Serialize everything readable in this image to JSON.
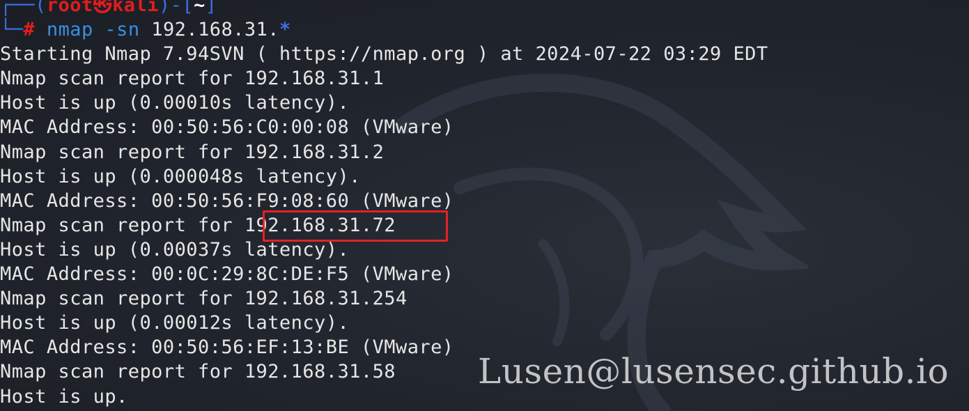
{
  "prompt": {
    "corner_top": "┌──(",
    "user": "root㉿kali",
    "close_bracket": ")-[",
    "cwd": "~",
    "end_bracket": "]",
    "corner_bottom": "└─",
    "hash": "#"
  },
  "command": {
    "program": "nmap",
    "flag": "-sn",
    "target": "192.168.31.",
    "wildcard": "*"
  },
  "output": [
    "Starting Nmap 7.94SVN ( https://nmap.org ) at 2024-07-22 03:29 EDT",
    "Nmap scan report for 192.168.31.1",
    "Host is up (0.00010s latency).",
    "MAC Address: 00:50:56:C0:00:08 (VMware)",
    "Nmap scan report for 192.168.31.2",
    "Host is up (0.000048s latency).",
    "MAC Address: 00:50:56:F9:08:60 (VMware)",
    "Nmap scan report for 192.168.31.72",
    "Host is up (0.00037s latency).",
    "MAC Address: 00:0C:29:8C:DE:F5 (VMware)",
    "Nmap scan report for 192.168.31.254",
    "Host is up (0.00012s latency).",
    "MAC Address: 00:50:56:EF:13:BE (VMware)",
    "Nmap scan report for 192.168.31.58",
    "Host is up."
  ],
  "highlighted_ip": "192.168.31.72",
  "watermark": "Lusen@lusensec.github.io",
  "colors": {
    "highlight_box": "#e32222",
    "prompt_user": "#e11d1d",
    "prompt_lines": "#3c6ee8",
    "command": "#3a8fe0",
    "background": "#20242c"
  }
}
